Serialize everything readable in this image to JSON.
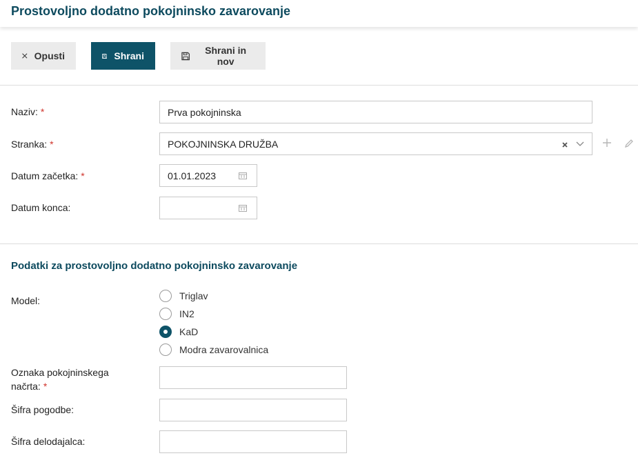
{
  "header": {
    "title": "Prostovoljno dodatno pokojninsko zavarovanje"
  },
  "toolbar": {
    "cancel_label": "Opusti",
    "save_label": "Shrani",
    "save_new_label": "Shrani in nov"
  },
  "form": {
    "naziv": {
      "label": "Naziv:",
      "required": "*",
      "value": "Prva pokojninska"
    },
    "stranka": {
      "label": "Stranka:",
      "required": "*",
      "value": "POKOJNINSKA DRUŽBA"
    },
    "datum_zacetka": {
      "label": "Datum začetka:",
      "required": "*",
      "value": "01.01.2023"
    },
    "datum_konca": {
      "label": "Datum konca:",
      "value": ""
    }
  },
  "section": {
    "title": "Podatki za prostovoljno dodatno pokojninsko zavarovanje",
    "model": {
      "label": "Model:",
      "options": [
        "Triglav",
        "IN2",
        "KaD",
        "Modra zavarovalnica"
      ],
      "selected": "KaD"
    },
    "oznaka": {
      "label_line1": "Oznaka pokojninskega",
      "label_line2": "načrta:",
      "required": "*",
      "value": ""
    },
    "sifra_pogodbe": {
      "label": "Šifra pogodbe:",
      "value": ""
    },
    "sifra_delodajalca": {
      "label": "Šifra delodajalca:",
      "value": ""
    }
  },
  "colors": {
    "primary": "#0e5368",
    "title": "#0d4a5e",
    "required": "#d0342c"
  }
}
